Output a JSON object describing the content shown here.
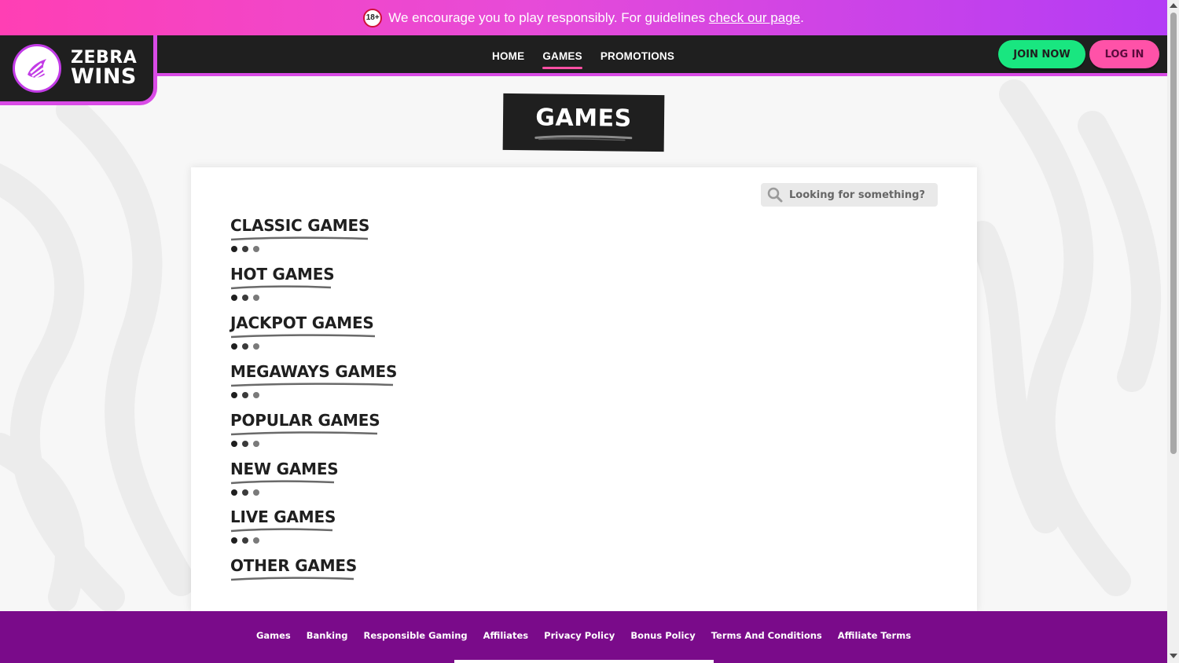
{
  "notice": {
    "age_badge": "18+",
    "text": "We encourage you to play responsibly. For guidelines ",
    "link": "check our page",
    "period": "."
  },
  "brand": {
    "line1": "ZEBRA",
    "line2": "WINS",
    "accent": "#d94be6"
  },
  "nav": {
    "items": [
      {
        "label": "HOME"
      },
      {
        "label": "GAMES"
      },
      {
        "label": "PROMOTIONS"
      }
    ],
    "active": "GAMES"
  },
  "buttons": {
    "join": "JOIN NOW",
    "login": "LOG IN"
  },
  "page": {
    "title": "GAMES"
  },
  "search": {
    "placeholder": "Looking for something?",
    "icon": "search-icon"
  },
  "categories": [
    {
      "label": "CLASSIC GAMES"
    },
    {
      "label": "HOT GAMES"
    },
    {
      "label": "JACKPOT GAMES"
    },
    {
      "label": "MEGAWAYS GAMES"
    },
    {
      "label": "POPULAR GAMES"
    },
    {
      "label": "NEW GAMES"
    },
    {
      "label": "LIVE GAMES"
    },
    {
      "label": "OTHER GAMES"
    }
  ],
  "footer": {
    "links": [
      "Games",
      "Banking",
      "Responsible Gaming",
      "Affiliates",
      "Privacy Policy",
      "Bonus Policy",
      "Terms And Conditions",
      "Affiliate Terms"
    ]
  },
  "colors": {
    "join_button": "#19e680",
    "login_button": "#ff52a8",
    "footer": "#7a0b8a",
    "notice_start": "#ff3fb4",
    "notice_end": "#b33cf5"
  }
}
